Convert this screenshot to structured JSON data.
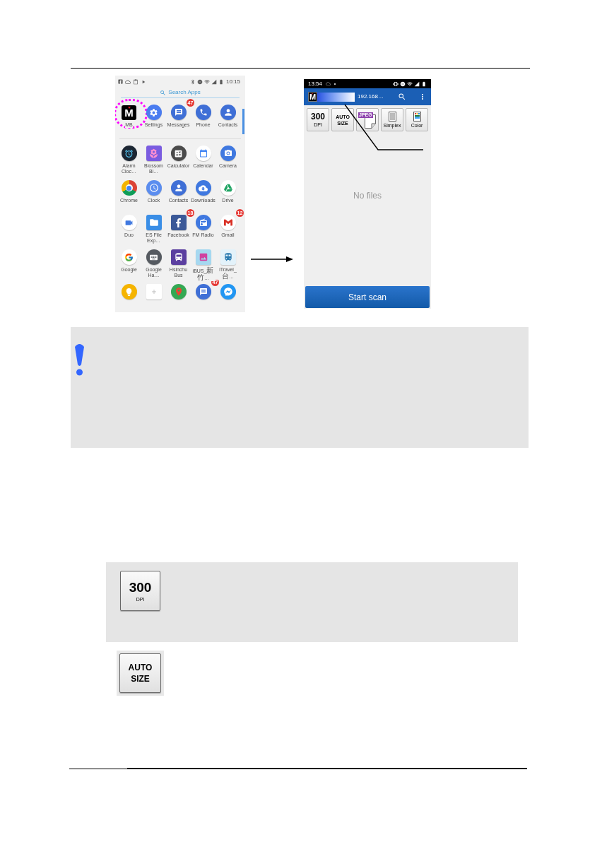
{
  "app_drawer": {
    "status_time": "10:15",
    "search": {
      "placeholder": "Search Apps"
    },
    "apps": [
      {
        "kind": "logo",
        "letter": "M",
        "label": "MB",
        "highlighted": true
      },
      {
        "kind": "settings",
        "label": "Settings",
        "highlighted": false
      },
      {
        "kind": "messages",
        "label": "Messages",
        "badge": "47",
        "highlighted": false
      },
      {
        "kind": "phone",
        "label": "Phone",
        "highlighted": false
      },
      {
        "kind": "contacts",
        "label": "Contacts",
        "highlighted": false
      },
      {
        "kind": "alarm",
        "label": "Alarm Cloc…",
        "highlighted": false
      },
      {
        "kind": "blossom",
        "label": "Blossom Bl…",
        "highlighted": false
      },
      {
        "kind": "calculator",
        "label": "Calculator",
        "highlighted": false
      },
      {
        "kind": "calendar",
        "label": "Calendar",
        "highlighted": false
      },
      {
        "kind": "camera",
        "label": "Camera",
        "highlighted": false
      },
      {
        "kind": "chrome",
        "label": "Chrome",
        "highlighted": false
      },
      {
        "kind": "clock",
        "label": "Clock",
        "highlighted": false
      },
      {
        "kind": "contacts",
        "label": "Contacts",
        "highlighted": false
      },
      {
        "kind": "downloads",
        "label": "Downloads",
        "highlighted": false
      },
      {
        "kind": "drive",
        "label": "Drive",
        "highlighted": false
      },
      {
        "kind": "duo",
        "label": "Duo",
        "highlighted": false
      },
      {
        "kind": "files",
        "label": "ES File Exp…",
        "highlighted": false
      },
      {
        "kind": "facebook",
        "label": "Facebook",
        "badge": "18",
        "highlighted": false
      },
      {
        "kind": "radio",
        "label": "FM Radio",
        "highlighted": false
      },
      {
        "kind": "gmail",
        "label": "Gmail",
        "badge": "12",
        "highlighted": false
      },
      {
        "kind": "google",
        "label": "Google",
        "highlighted": false
      },
      {
        "kind": "keyboard",
        "label": "Google Ha…",
        "highlighted": false
      },
      {
        "kind": "bus",
        "label": "Hsinchu Bus",
        "highlighted": false
      },
      {
        "kind": "photo",
        "label": "iBUS_新竹…",
        "highlighted": false
      },
      {
        "kind": "travel",
        "label": "iTravel_台…",
        "highlighted": false
      },
      {
        "kind": "bulb",
        "highlighted": false
      },
      {
        "kind": "card",
        "highlighted": false
      },
      {
        "kind": "maps",
        "highlighted": false
      },
      {
        "kind": "messages",
        "badge": "47",
        "highlighted": false
      },
      {
        "kind": "messenger",
        "highlighted": false
      }
    ]
  },
  "scanner_app": {
    "status_time": "13:54",
    "logo_letter": "M",
    "address": "192.168…",
    "tools": [
      {
        "kind": "big-number",
        "texts": [
          "300",
          "DPI"
        ]
      },
      {
        "kind": "two-line",
        "texts": [
          "AUTO",
          "SIZE"
        ]
      },
      {
        "kind": "file-type",
        "texts": [
          "JPEG"
        ]
      },
      {
        "kind": "doc",
        "texts": [
          "Simplex"
        ]
      },
      {
        "kind": "color-doc",
        "texts": [
          "Color"
        ]
      }
    ],
    "empty_message": "No files",
    "scan_button": "Start scan"
  },
  "note": {
    "kind": "warning"
  },
  "options": [
    {
      "kind": "big-number",
      "texts": [
        "300",
        "DPI"
      ],
      "shaded": true
    },
    {
      "kind": "two-line",
      "texts": [
        "AUTO",
        "SIZE"
      ],
      "shaded": false
    }
  ]
}
